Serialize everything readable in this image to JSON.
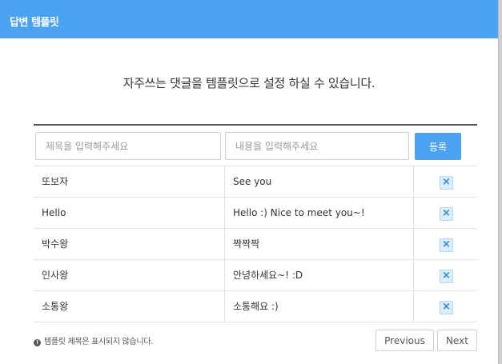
{
  "header": {
    "title": "답변 템플릿"
  },
  "subtitle": "자주쓰는 댓글을 템플릿으로 설정 하실 수 있습니다.",
  "form": {
    "title_placeholder": "제목을 입력해주세요",
    "content_placeholder": "내용을 입력해주세요",
    "register_label": "등록"
  },
  "rows": [
    {
      "title": "또보자",
      "content": "See you"
    },
    {
      "title": "Hello",
      "content": "Hello :) Nice to meet you~!"
    },
    {
      "title": "박수왕",
      "content": "짝짝짝"
    },
    {
      "title": "인사왕",
      "content": "안녕하세요~! :D"
    },
    {
      "title": "소통왕",
      "content": "소통해요 :)"
    }
  ],
  "delete_symbol": "×",
  "notice": {
    "icon": "!",
    "text": "템플릿 제목은 표시되지 않습니다."
  },
  "pagination": {
    "previous": "Previous",
    "next": "Next"
  },
  "colors": {
    "accent": "#4aa3f2"
  }
}
